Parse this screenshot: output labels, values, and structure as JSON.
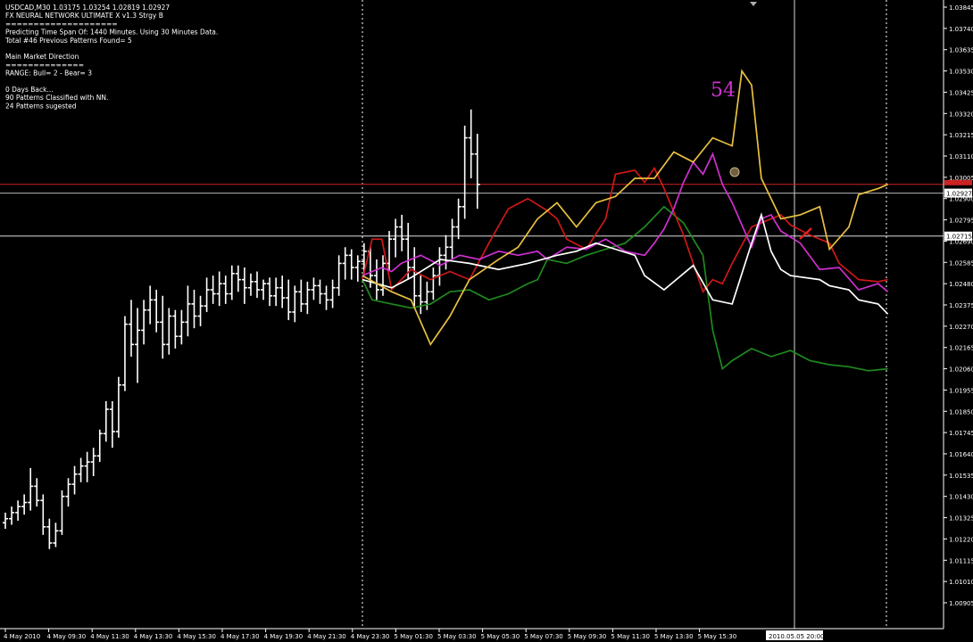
{
  "info_panel": {
    "lines": [
      "USDCAD,M30  1.03175 1.03254 1.02819 1.02927",
      "FX NEURAL NETWORK ULTIMATE X v1.3 Strgy B",
      "====================",
      "Predicting Time Span Of: 1440 Minutes. Using 30 Minutes Data.",
      "Total #46 Previous Patterns Found= 5",
      "",
      "Main Market Direction",
      "==============",
      "RANGE: Bull= 2 -  Bear= 3",
      "",
      "0 Days Back...",
      "90 Patterns Classified with NN.",
      "24 Patterns sugested"
    ]
  },
  "annotation": {
    "pattern_count": "54",
    "color": "#cc33cc"
  },
  "colors": {
    "background": "#000000",
    "bars": "#ffffff",
    "grid_dotted": "#ffffff",
    "hline_red": "#cc2222",
    "hline_gray": "#b8b8b8",
    "series_white": "#ffffff",
    "series_yellow": "#e8c040",
    "series_red": "#d01818",
    "series_magenta": "#d030d0",
    "series_green": "#1e8a1e"
  },
  "chart_data": {
    "type": "line",
    "symbol": "USDCAD",
    "timeframe": "M30",
    "ylim": [
      1.009,
      1.0385
    ],
    "price_ticks": [
      "1.03845",
      "1.03740",
      "1.03635",
      "1.03530",
      "1.03425",
      "1.03320",
      "1.03215",
      "1.03110",
      "1.03005",
      "1.02900",
      "1.02795",
      "1.02690",
      "1.02585",
      "1.02480",
      "1.02375",
      "1.02270",
      "1.02165",
      "1.02060",
      "1.01955",
      "1.01850",
      "1.01745",
      "1.01640",
      "1.01535",
      "1.01430",
      "1.01325",
      "1.01220",
      "1.01115",
      "1.01010",
      "1.00905"
    ],
    "current_price_label": "1.02927",
    "hline_label": "1.02715",
    "red_line_price": 1.0297,
    "gray_line_price": 1.02927,
    "white_line_price": 1.02715,
    "time_labels": [
      "4 May 2010",
      "4 May 09:30",
      "4 May 11:30",
      "4 May 13:30",
      "4 May 15:30",
      "4 May 17:30",
      "4 May 19:30",
      "4 May 21:30",
      "4 May 23:30",
      "5 May 01:30",
      "5 May 03:30",
      "5 May 05:30",
      "5 May 07:30",
      "5 May 09:30",
      "5 May 11:30",
      "5 May 13:30",
      "5 May 15:30"
    ],
    "cursor_time_label": "2010.05.05 20:00",
    "bars": [
      [
        1.013,
        1.0135,
        1.0127,
        1.0132
      ],
      [
        1.0132,
        1.0138,
        1.0129,
        1.0135
      ],
      [
        1.0135,
        1.0141,
        1.0131,
        1.0138
      ],
      [
        1.0138,
        1.0144,
        1.0134,
        1.014
      ],
      [
        1.014,
        1.0157,
        1.0136,
        1.0148
      ],
      [
        1.0148,
        1.0152,
        1.0138,
        1.0141
      ],
      [
        1.0141,
        1.0144,
        1.0124,
        1.0128
      ],
      [
        1.0128,
        1.0132,
        1.0117,
        1.012
      ],
      [
        1.012,
        1.013,
        1.0118,
        1.0126
      ],
      [
        1.0126,
        1.0146,
        1.0124,
        1.0143
      ],
      [
        1.0143,
        1.0152,
        1.0138,
        1.0149
      ],
      [
        1.0149,
        1.0158,
        1.0144,
        1.0154
      ],
      [
        1.0154,
        1.0162,
        1.015,
        1.0158
      ],
      [
        1.0158,
        1.0165,
        1.015,
        1.016
      ],
      [
        1.016,
        1.0167,
        1.0153,
        1.0163
      ],
      [
        1.0163,
        1.0176,
        1.016,
        1.0174
      ],
      [
        1.0174,
        1.019,
        1.017,
        1.0186
      ],
      [
        1.0186,
        1.019,
        1.0167,
        1.0175
      ],
      [
        1.0175,
        1.0202,
        1.0172,
        1.0198
      ],
      [
        1.0198,
        1.0232,
        1.0195,
        1.0228
      ],
      [
        1.0228,
        1.024,
        1.0212,
        1.0218
      ],
      [
        1.0218,
        1.0236,
        1.0199,
        1.0225
      ],
      [
        1.0225,
        1.024,
        1.0218,
        1.0235
      ],
      [
        1.0235,
        1.0247,
        1.0228,
        1.024
      ],
      [
        1.024,
        1.0245,
        1.0224,
        1.0229
      ],
      [
        1.0229,
        1.0242,
        1.0211,
        1.0218
      ],
      [
        1.0218,
        1.0236,
        1.0213,
        1.0232
      ],
      [
        1.0232,
        1.0235,
        1.0216,
        1.0222
      ],
      [
        1.0222,
        1.0235,
        1.0218,
        1.0229
      ],
      [
        1.0229,
        1.0247,
        1.0222,
        1.0238
      ],
      [
        1.0238,
        1.0245,
        1.0226,
        1.0232
      ],
      [
        1.0232,
        1.0242,
        1.0227,
        1.0237
      ],
      [
        1.0237,
        1.0251,
        1.0234,
        1.0245
      ],
      [
        1.0245,
        1.0252,
        1.0238,
        1.0243
      ],
      [
        1.0243,
        1.0254,
        1.0237,
        1.0248
      ],
      [
        1.0248,
        1.0252,
        1.0238,
        1.0243
      ],
      [
        1.0243,
        1.0257,
        1.024,
        1.0253
      ],
      [
        1.0253,
        1.0257,
        1.0244,
        1.025
      ],
      [
        1.025,
        1.0256,
        1.0238,
        1.0246
      ],
      [
        1.0246,
        1.0253,
        1.0242,
        1.0249
      ],
      [
        1.0249,
        1.0254,
        1.0241,
        1.0245
      ],
      [
        1.0245,
        1.025,
        1.024,
        1.0248
      ],
      [
        1.0248,
        1.0251,
        1.0237,
        1.0242
      ],
      [
        1.0242,
        1.0251,
        1.0237,
        1.0246
      ],
      [
        1.0246,
        1.0252,
        1.0236,
        1.0241
      ],
      [
        1.0241,
        1.025,
        1.023,
        1.0234
      ],
      [
        1.0234,
        1.0247,
        1.0229,
        1.0244
      ],
      [
        1.0244,
        1.025,
        1.0234,
        1.0238
      ],
      [
        1.0238,
        1.0249,
        1.0233,
        1.0245
      ],
      [
        1.0245,
        1.0251,
        1.024,
        1.0247
      ],
      [
        1.0247,
        1.025,
        1.0238,
        1.0243
      ],
      [
        1.0243,
        1.0247,
        1.0235,
        1.024
      ],
      [
        1.024,
        1.025,
        1.0236,
        1.0246
      ],
      [
        1.0246,
        1.0262,
        1.0242,
        1.0258
      ],
      [
        1.0258,
        1.0266,
        1.025,
        1.0262
      ],
      [
        1.0262,
        1.0265,
        1.025,
        1.0256
      ],
      [
        1.0256,
        1.0262,
        1.0249,
        1.0259
      ],
      [
        1.0259,
        1.0268,
        1.0252,
        1.0264
      ],
      [
        1.0264,
        1.0266,
        1.0246,
        1.0252
      ],
      [
        1.0252,
        1.026,
        1.024,
        1.0245
      ],
      [
        1.0245,
        1.0262,
        1.0242,
        1.0258
      ],
      [
        1.0258,
        1.0274,
        1.0254,
        1.027
      ],
      [
        1.027,
        1.028,
        1.0261,
        1.0276
      ],
      [
        1.0276,
        1.0282,
        1.0264,
        1.027
      ],
      [
        1.027,
        1.0278,
        1.025,
        1.0256
      ],
      [
        1.0256,
        1.0266,
        1.0237,
        1.0242
      ],
      [
        1.0242,
        1.0252,
        1.0233,
        1.0239
      ],
      [
        1.0239,
        1.0249,
        1.0235,
        1.0244
      ],
      [
        1.0244,
        1.0256,
        1.024,
        1.0252
      ],
      [
        1.0252,
        1.0266,
        1.0247,
        1.0262
      ],
      [
        1.0262,
        1.0272,
        1.0255,
        1.0266
      ],
      [
        1.0266,
        1.028,
        1.026,
        1.0276
      ],
      [
        1.0276,
        1.029,
        1.027,
        1.0286
      ],
      [
        1.0286,
        1.0326,
        1.028,
        1.032
      ],
      [
        1.032,
        1.0334,
        1.03,
        1.0312
      ],
      [
        1.0312,
        1.0322,
        1.0285,
        1.0297
      ]
    ],
    "series": [
      {
        "key": "white",
        "points": [
          [
            0,
            1.025
          ],
          [
            3,
            1.0246
          ],
          [
            5,
            1.0251
          ],
          [
            8,
            1.026
          ],
          [
            11,
            1.0258
          ],
          [
            14,
            1.0255
          ],
          [
            17,
            1.0258
          ],
          [
            20,
            1.0262
          ],
          [
            22,
            1.0264
          ],
          [
            24,
            1.0268
          ],
          [
            26,
            1.0265
          ],
          [
            28,
            1.0262
          ],
          [
            29,
            1.0252
          ],
          [
            31,
            1.0245
          ],
          [
            34,
            1.0257
          ],
          [
            36,
            1.024
          ],
          [
            38,
            1.0238
          ],
          [
            40,
            1.0268
          ],
          [
            41,
            1.0282
          ],
          [
            42,
            1.0264
          ],
          [
            43,
            1.0255
          ],
          [
            44,
            1.0252
          ],
          [
            47,
            1.025
          ],
          [
            48,
            1.0247
          ],
          [
            50,
            1.0245
          ],
          [
            51,
            1.024
          ],
          [
            53,
            1.0238
          ],
          [
            54,
            1.0233
          ]
        ]
      },
      {
        "key": "yellow",
        "points": [
          [
            0,
            1.0252
          ],
          [
            3,
            1.0244
          ],
          [
            5,
            1.024
          ],
          [
            7,
            1.0218
          ],
          [
            9,
            1.0232
          ],
          [
            11,
            1.025
          ],
          [
            14,
            1.026
          ],
          [
            16,
            1.0266
          ],
          [
            18,
            1.028
          ],
          [
            20,
            1.0288
          ],
          [
            22,
            1.0276
          ],
          [
            24,
            1.0288
          ],
          [
            26,
            1.0291
          ],
          [
            28,
            1.03
          ],
          [
            30,
            1.03
          ],
          [
            32,
            1.0313
          ],
          [
            34,
            1.0308
          ],
          [
            36,
            1.032
          ],
          [
            38,
            1.0316
          ],
          [
            39,
            1.0353
          ],
          [
            40,
            1.0346
          ],
          [
            41,
            1.03
          ],
          [
            43,
            1.028
          ],
          [
            45,
            1.0282
          ],
          [
            47,
            1.0286
          ],
          [
            48,
            1.0265
          ],
          [
            50,
            1.0276
          ],
          [
            51,
            1.0292
          ],
          [
            53,
            1.0295
          ],
          [
            54,
            1.0297
          ]
        ]
      },
      {
        "key": "red",
        "points": [
          [
            0,
            1.025
          ],
          [
            1,
            1.027
          ],
          [
            2,
            1.027
          ],
          [
            3,
            1.0245
          ],
          [
            5,
            1.0255
          ],
          [
            7,
            1.025
          ],
          [
            9,
            1.0254
          ],
          [
            11,
            1.025
          ],
          [
            13,
            1.0268
          ],
          [
            15,
            1.0285
          ],
          [
            17,
            1.029
          ],
          [
            19,
            1.0284
          ],
          [
            20,
            1.028
          ],
          [
            21,
            1.027
          ],
          [
            23,
            1.0265
          ],
          [
            25,
            1.028
          ],
          [
            26,
            1.0302
          ],
          [
            28,
            1.0304
          ],
          [
            29,
            1.0298
          ],
          [
            30,
            1.0305
          ],
          [
            31,
            1.0295
          ],
          [
            33,
            1.0272
          ],
          [
            34,
            1.0258
          ],
          [
            35,
            1.0244
          ],
          [
            36,
            1.025
          ],
          [
            37,
            1.0248
          ],
          [
            38,
            1.0258
          ],
          [
            40,
            1.0276
          ],
          [
            43,
            1.0282
          ],
          [
            44,
            1.0277
          ],
          [
            46,
            1.0272
          ],
          [
            48,
            1.0268
          ],
          [
            49,
            1.0258
          ],
          [
            51,
            1.025
          ],
          [
            53,
            1.0249
          ],
          [
            54,
            1.025
          ]
        ]
      },
      {
        "key": "magenta",
        "points": [
          [
            0,
            1.0252
          ],
          [
            2,
            1.0256
          ],
          [
            3,
            1.0254
          ],
          [
            4,
            1.0258
          ],
          [
            6,
            1.0262
          ],
          [
            8,
            1.0257
          ],
          [
            10,
            1.0262
          ],
          [
            12,
            1.026
          ],
          [
            14,
            1.0264
          ],
          [
            16,
            1.0262
          ],
          [
            18,
            1.0264
          ],
          [
            19,
            1.026
          ],
          [
            21,
            1.0266
          ],
          [
            23,
            1.0265
          ],
          [
            25,
            1.027
          ],
          [
            27,
            1.0264
          ],
          [
            29,
            1.0262
          ],
          [
            30,
            1.0268
          ],
          [
            31,
            1.0275
          ],
          [
            32,
            1.0285
          ],
          [
            33,
            1.0298
          ],
          [
            34,
            1.0308
          ],
          [
            35,
            1.0302
          ],
          [
            36,
            1.0312
          ],
          [
            37,
            1.0297
          ],
          [
            38,
            1.0288
          ],
          [
            40,
            1.0266
          ],
          [
            41,
            1.028
          ],
          [
            42,
            1.0282
          ],
          [
            43,
            1.0274
          ],
          [
            45,
            1.0268
          ],
          [
            47,
            1.0255
          ],
          [
            49,
            1.0256
          ],
          [
            51,
            1.0245
          ],
          [
            53,
            1.0248
          ],
          [
            54,
            1.0244
          ]
        ]
      },
      {
        "key": "green",
        "points": [
          [
            0,
            1.025
          ],
          [
            1,
            1.024
          ],
          [
            3,
            1.0238
          ],
          [
            5,
            1.0236
          ],
          [
            7,
            1.0238
          ],
          [
            9,
            1.0244
          ],
          [
            11,
            1.0245
          ],
          [
            13,
            1.024
          ],
          [
            15,
            1.0243
          ],
          [
            17,
            1.0248
          ],
          [
            18,
            1.025
          ],
          [
            19,
            1.026
          ],
          [
            21,
            1.0258
          ],
          [
            23,
            1.0262
          ],
          [
            25,
            1.0265
          ],
          [
            27,
            1.0268
          ],
          [
            29,
            1.0276
          ],
          [
            31,
            1.0286
          ],
          [
            33,
            1.0278
          ],
          [
            35,
            1.0262
          ],
          [
            36,
            1.0225
          ],
          [
            37,
            1.0206
          ],
          [
            38,
            1.021
          ],
          [
            40,
            1.0216
          ],
          [
            42,
            1.0212
          ],
          [
            44,
            1.0215
          ],
          [
            46,
            1.021
          ],
          [
            48,
            1.0208
          ],
          [
            50,
            1.0207
          ],
          [
            52,
            1.0205
          ],
          [
            54,
            1.0206
          ]
        ]
      }
    ],
    "forecast_start_bar": 56
  }
}
